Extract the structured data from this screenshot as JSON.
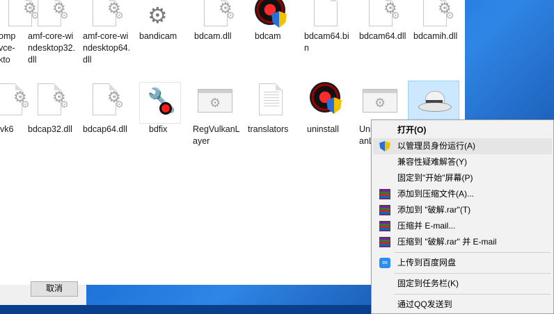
{
  "row1": [
    {
      "label": "omp\nvce-\nkto",
      "icon": "gear-document-icon"
    },
    {
      "label": "amf-core-windesktop32.dll",
      "icon": "gear-document-icon"
    },
    {
      "label": "amf-core-windesktop64.dll",
      "icon": "gear-document-icon"
    },
    {
      "label": "bandicam",
      "icon": "gear-icon"
    },
    {
      "label": "bdcam.dll",
      "icon": "gear-document-icon"
    },
    {
      "label": "bdcam",
      "icon": "record-shield-icon"
    },
    {
      "label": "bdcam64.bin",
      "icon": "document-icon"
    },
    {
      "label": "bdcam64.dll",
      "icon": "gear-document-icon"
    },
    {
      "label": "bdcamih.dll",
      "icon": "gear-document-icon"
    }
  ],
  "row2": [
    {
      "label": "vk6",
      "icon": "gear-document-icon"
    },
    {
      "label": "bdcap32.dll",
      "icon": "gear-document-icon"
    },
    {
      "label": "bdcap64.dll",
      "icon": "gear-document-icon"
    },
    {
      "label": "bdfix",
      "icon": "tools-icon"
    },
    {
      "label": "RegVulkanLayer",
      "icon": "registry-icon"
    },
    {
      "label": "translators",
      "icon": "text-document-icon"
    },
    {
      "label": "uninstall",
      "icon": "record-shield-icon"
    },
    {
      "label": "Uni\nanL",
      "icon": "gear-window-icon"
    },
    {
      "label": "",
      "icon": "white-hat-icon"
    }
  ],
  "cancel_label": "取消",
  "context_menu": {
    "items": [
      {
        "label": "打开(O)",
        "icon": "",
        "bold": true
      },
      {
        "label": "以管理员身份运行(A)",
        "icon": "shield-icon",
        "hover": true
      },
      {
        "label": "兼容性疑难解答(Y)",
        "icon": ""
      },
      {
        "label": "固定到\"开始\"屏幕(P)",
        "icon": ""
      },
      {
        "label": "添加到压缩文件(A)...",
        "icon": "winrar-icon"
      },
      {
        "label": "添加到 \"破解.rar\"(T)",
        "icon": "winrar-icon"
      },
      {
        "label": "压缩并 E-mail...",
        "icon": "winrar-icon"
      },
      {
        "label": "压缩到 \"破解.rar\" 并 E-mail",
        "icon": "winrar-icon"
      },
      {
        "label": "上传到百度网盘",
        "icon": "baidu-netdisk-icon"
      },
      {
        "label": "固定到任务栏(K)",
        "icon": ""
      },
      {
        "label": "通过QQ发送到",
        "icon": ""
      }
    ]
  }
}
